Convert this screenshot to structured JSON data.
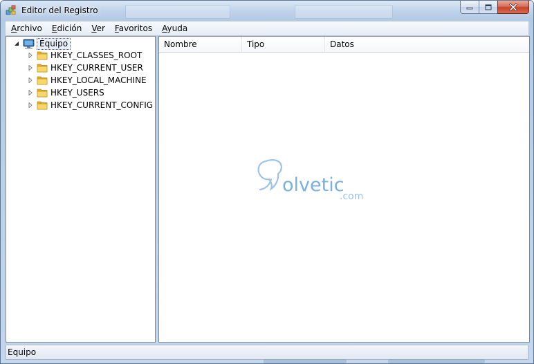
{
  "window": {
    "title": "Editor del Registro"
  },
  "menu": {
    "items": [
      {
        "ul": "A",
        "rest": "rchivo"
      },
      {
        "ul": "E",
        "rest": "dición"
      },
      {
        "ul": "V",
        "rest": "er"
      },
      {
        "ul": "F",
        "rest": "avoritos"
      },
      {
        "ul": "A",
        "rest": "yuda"
      }
    ]
  },
  "tree": {
    "root": "Equipo",
    "keys": [
      "HKEY_CLASSES_ROOT",
      "HKEY_CURRENT_USER",
      "HKEY_LOCAL_MACHINE",
      "HKEY_USERS",
      "HKEY_CURRENT_CONFIG"
    ]
  },
  "list": {
    "columns": [
      "Nombre",
      "Tipo",
      "Datos"
    ]
  },
  "watermark": {
    "brand": "olvetic",
    "suffix": ".com"
  },
  "status": {
    "text": "Equipo"
  },
  "colors": {
    "folder": "#f2c64a",
    "accent": "#4a8fd6",
    "close": "#c7432a"
  }
}
